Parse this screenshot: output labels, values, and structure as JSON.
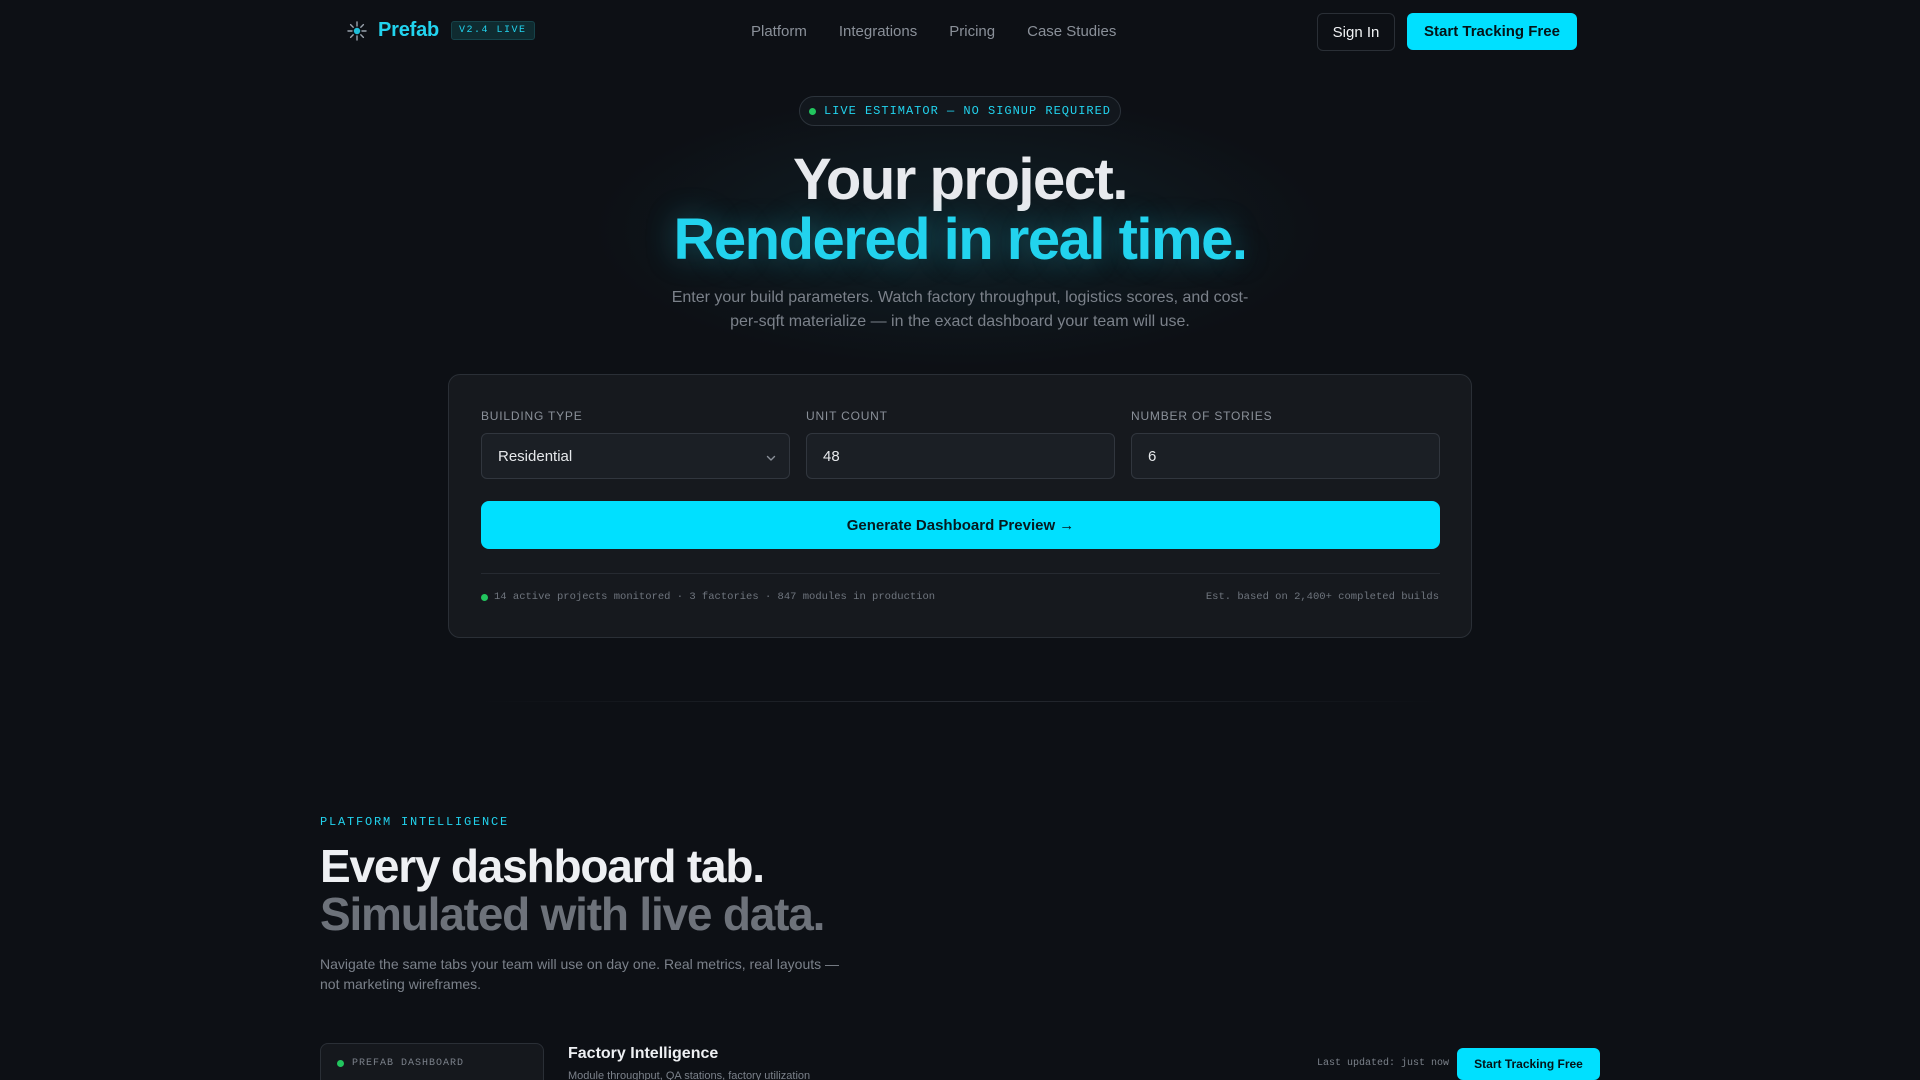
{
  "nav": {
    "brand": "Prefab",
    "version_badge": "V2.4 LIVE",
    "links": [
      "Platform",
      "Integrations",
      "Pricing",
      "Case Studies"
    ],
    "signin_label": "Sign In",
    "cta_label": "Start Tracking Free"
  },
  "hero": {
    "pill_label": "LIVE ESTIMATOR — NO SIGNUP REQUIRED",
    "title_line1": "Your project.",
    "title_line2": "Rendered in real time.",
    "subtitle": "Enter your build parameters. Watch factory throughput, logistics scores, and cost-per-sqft materialize — in the exact dashboard your team will use."
  },
  "estimator": {
    "building_type_label": "BUILDING TYPE",
    "building_type_value": "Residential",
    "unit_count_label": "UNIT COUNT",
    "unit_count_value": "48",
    "stories_label": "NUMBER OF STORIES",
    "stories_value": "6",
    "generate_label": "Generate Dashboard Preview →",
    "stats": "14 active projects monitored · 3 factories · 847 modules in production",
    "note": "Est. based on 2,400+ completed builds"
  },
  "platform": {
    "eyebrow": "PLATFORM INTELLIGENCE",
    "title_line1": "Every dashboard tab.",
    "title_line2": "Simulated with live data.",
    "subtitle": "Navigate the same tabs your team will use on day one. Real metrics, real layouts — not marketing wireframes.",
    "dash_tab_label": "PREFAB DASHBOARD",
    "section_title": "Factory Intelligence",
    "section_sub": "Module throughput, QA stations, factory utilization",
    "last_updated": "Last updated: just now",
    "cta_label": "Start Tracking Free"
  },
  "colors": {
    "background": "#0d1015",
    "accent": "#00e0ff",
    "accent_text": "#22d3ee",
    "live_dot": "#22c55e"
  },
  "icons": {
    "brand": "spark-logo-icon",
    "select": "chevron-down-icon",
    "status": "live-dot-icon"
  }
}
